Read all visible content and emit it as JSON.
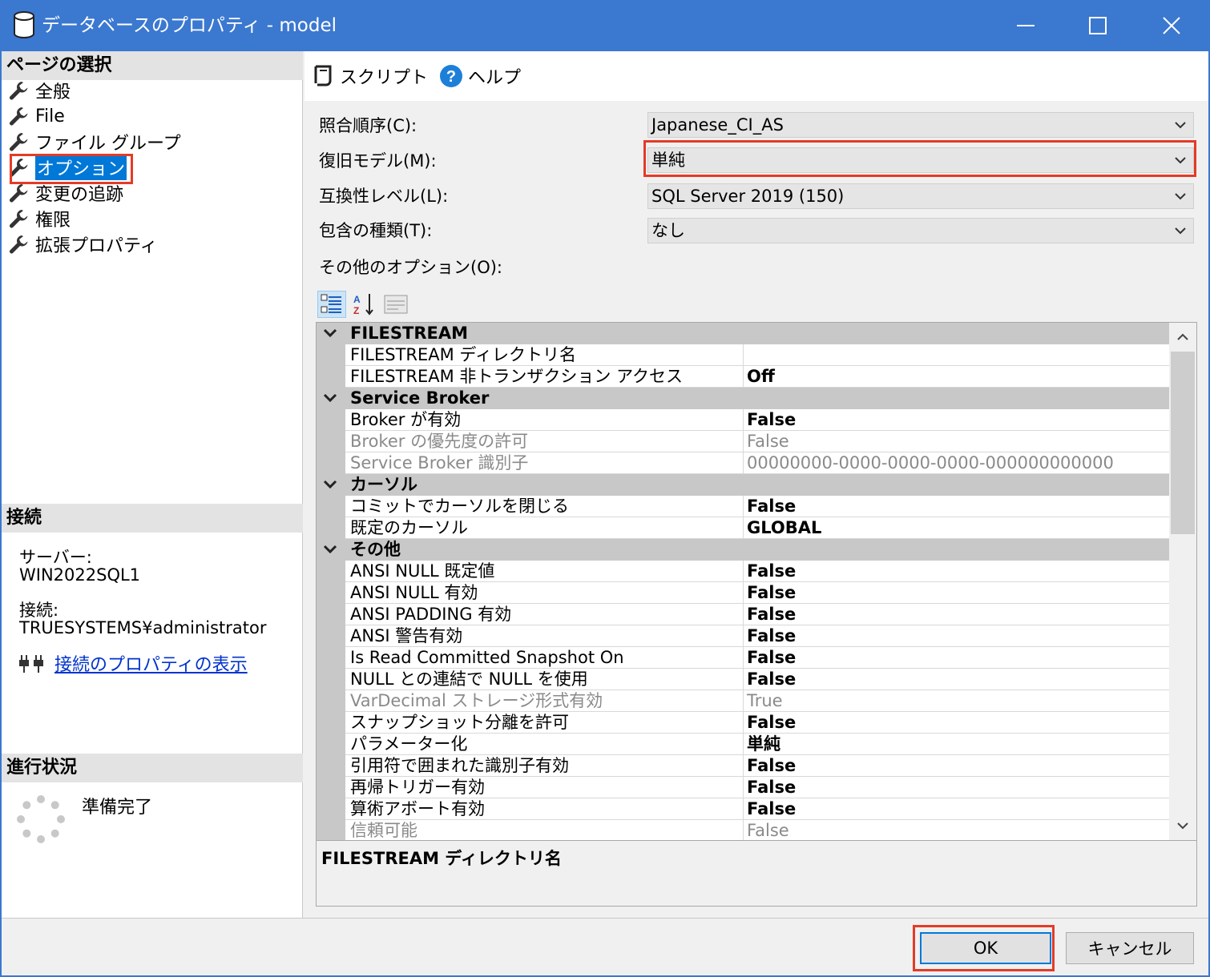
{
  "window": {
    "title": "データベースのプロパティ - model",
    "icons": [
      "database-icon",
      "minimize-icon",
      "maximize-icon",
      "close-icon"
    ]
  },
  "left_pane": {
    "page_select_title": "ページの選択",
    "pages": [
      {
        "label": "全般",
        "icon": "wrench-icon"
      },
      {
        "label": "File",
        "icon": "wrench-icon"
      },
      {
        "label": "ファイル グループ",
        "icon": "wrench-icon"
      },
      {
        "label": "オプション",
        "icon": "wrench-icon",
        "selected": true
      },
      {
        "label": "変更の追跡",
        "icon": "wrench-icon"
      },
      {
        "label": "権限",
        "icon": "wrench-icon"
      },
      {
        "label": "拡張プロパティ",
        "icon": "wrench-icon"
      }
    ],
    "connection": {
      "title": "接続",
      "server_label": "サーバー:",
      "server_value": "WIN2022SQL1",
      "connection_label": "接続:",
      "connection_value": "TRUESYSTEMS¥administrator",
      "view_properties_link": "接続のプロパティの表示"
    },
    "progress": {
      "title": "進行状況",
      "status": "準備完了"
    }
  },
  "toolbar": {
    "script_label": "スクリプト",
    "help_label": "ヘルプ"
  },
  "form": {
    "collation_label": "照合順序(C):",
    "collation_value": "Japanese_CI_AS",
    "recovery_label": "復旧モデル(M):",
    "recovery_value": "単純",
    "compat_label": "互換性レベル(L):",
    "compat_value": "SQL Server 2019 (150)",
    "containment_label": "包含の種類(T):",
    "containment_value": "なし",
    "other_options_label": "その他のオプション(O):"
  },
  "property_grid": {
    "rows": [
      {
        "kind": "cat",
        "name": "FILESTREAM"
      },
      {
        "kind": "prop",
        "name": "FILESTREAM ディレクトリ名",
        "value": ""
      },
      {
        "kind": "prop",
        "name": "FILESTREAM 非トランザクション アクセス",
        "value": "Off"
      },
      {
        "kind": "cat",
        "name": "Service Broker"
      },
      {
        "kind": "prop",
        "name": "Broker が有効",
        "value": "False"
      },
      {
        "kind": "prop",
        "name": "Broker の優先度の許可",
        "value": "False",
        "dim": true
      },
      {
        "kind": "prop",
        "name": "Service Broker 識別子",
        "value": "00000000-0000-0000-0000-000000000000",
        "dim": true
      },
      {
        "kind": "cat",
        "name": "カーソル"
      },
      {
        "kind": "prop",
        "name": "コミットでカーソルを閉じる",
        "value": "False"
      },
      {
        "kind": "prop",
        "name": "既定のカーソル",
        "value": "GLOBAL"
      },
      {
        "kind": "cat",
        "name": "その他"
      },
      {
        "kind": "prop",
        "name": "ANSI NULL 既定値",
        "value": "False"
      },
      {
        "kind": "prop",
        "name": "ANSI NULL 有効",
        "value": "False"
      },
      {
        "kind": "prop",
        "name": "ANSI PADDING 有効",
        "value": "False"
      },
      {
        "kind": "prop",
        "name": "ANSI 警告有効",
        "value": "False"
      },
      {
        "kind": "prop",
        "name": "Is Read Committed Snapshot On",
        "value": "False"
      },
      {
        "kind": "prop",
        "name": "NULL との連結で NULL を使用",
        "value": "False"
      },
      {
        "kind": "prop",
        "name": "VarDecimal ストレージ形式有効",
        "value": "True",
        "dim": true
      },
      {
        "kind": "prop",
        "name": "スナップショット分離を許可",
        "value": "False"
      },
      {
        "kind": "prop",
        "name": "パラメーター化",
        "value": "単純"
      },
      {
        "kind": "prop",
        "name": "引用符で囲まれた識別子有効",
        "value": "False"
      },
      {
        "kind": "prop",
        "name": "再帰トリガー有効",
        "value": "False"
      },
      {
        "kind": "prop",
        "name": "算術アボート有効",
        "value": "False"
      },
      {
        "kind": "prop",
        "name": "信頼可能",
        "value": "False",
        "dim": true
      }
    ],
    "description_title": "FILESTREAM ディレクトリ名"
  },
  "buttons": {
    "ok": "OK",
    "cancel": "キャンセル"
  },
  "colors": {
    "titlebar": "#3b78d0",
    "selection": "#0078d7",
    "highlight_box": "#e33b27",
    "link": "#0033cc"
  }
}
